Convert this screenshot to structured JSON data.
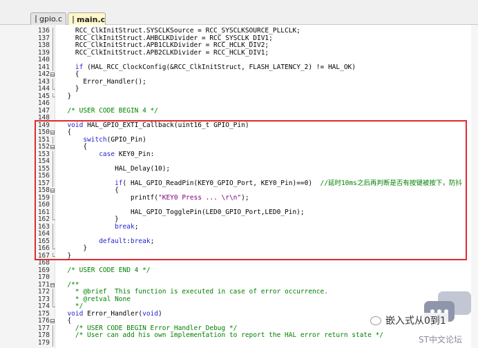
{
  "tabs": [
    {
      "label": "gpio.c",
      "active": false
    },
    {
      "label": "main.c",
      "active": true
    }
  ],
  "code_lines": [
    {
      "num": "136",
      "fold": "vline",
      "html": "    RCC_ClkInitStruct.SYSCLKSource = RCC_SYSCLKSOURCE_PLLCLK;"
    },
    {
      "num": "137",
      "fold": "vline",
      "html": "    RCC_ClkInitStruct.AHBCLKDivider = RCC_SYSCLK_DIV1;"
    },
    {
      "num": "138",
      "fold": "vline",
      "html": "    RCC_ClkInitStruct.APB1CLKDivider = RCC_HCLK_DIV2;"
    },
    {
      "num": "139",
      "fold": "vline",
      "html": "    RCC_ClkInitStruct.APB2CLKDivider = RCC_HCLK_DIV1;"
    },
    {
      "num": "140",
      "fold": "vline",
      "html": ""
    },
    {
      "num": "141",
      "fold": "vline",
      "html": "    <span class=\"k\">if</span> (HAL_RCC_ClockConfig(&RCC_ClkInitStruct, FLASH_LATENCY_2) != HAL_OK)"
    },
    {
      "num": "142",
      "fold": "box",
      "html": "    {"
    },
    {
      "num": "143",
      "fold": "vline",
      "html": "      Error_Handler();"
    },
    {
      "num": "144",
      "fold": "end",
      "html": "    }"
    },
    {
      "num": "145",
      "fold": "end",
      "html": "  }"
    },
    {
      "num": "146",
      "fold": "",
      "html": ""
    },
    {
      "num": "147",
      "fold": "",
      "html": "  <span class=\"c\">/* USER CODE BEGIN 4 */</span>"
    },
    {
      "num": "148",
      "fold": "",
      "html": ""
    },
    {
      "num": "149",
      "fold": "",
      "html": "  <span class=\"k\">void</span> HAL_GPIO_EXTI_Callback(uint16_t GPIO_Pin)"
    },
    {
      "num": "150",
      "fold": "box",
      "html": "  {"
    },
    {
      "num": "151",
      "fold": "vline",
      "html": "      <span class=\"k\">switch</span>(GPIO_Pin)"
    },
    {
      "num": "152",
      "fold": "box",
      "html": "      {"
    },
    {
      "num": "153",
      "fold": "vline",
      "html": "          <span class=\"k\">case</span> KEY0_Pin:"
    },
    {
      "num": "154",
      "fold": "vline",
      "html": ""
    },
    {
      "num": "155",
      "fold": "vline",
      "html": "              HAL_Delay(10);"
    },
    {
      "num": "156",
      "fold": "vline",
      "html": ""
    },
    {
      "num": "157",
      "fold": "vline",
      "html": "              <span class=\"k\">if</span>( HAL_GPIO_ReadPin(KEY0_GPIO_Port, KEY0_Pin)==0)  <span class=\"c\">//延时10ms之后再判断是否有按键被按下，防抖</span>"
    },
    {
      "num": "158",
      "fold": "box",
      "html": "              {"
    },
    {
      "num": "159",
      "fold": "vline",
      "html": "                  printf(<span class=\"s\">\"KEY0 Press ... \\r\\n\"</span>);"
    },
    {
      "num": "160",
      "fold": "vline",
      "html": ""
    },
    {
      "num": "161",
      "fold": "vline",
      "html": "                  HAL_GPIO_TogglePin(LED0_GPIO_Port,LED0_Pin);"
    },
    {
      "num": "162",
      "fold": "end",
      "html": "              }"
    },
    {
      "num": "163",
      "fold": "vline",
      "html": "              <span class=\"k\">break</span>;"
    },
    {
      "num": "164",
      "fold": "vline",
      "html": ""
    },
    {
      "num": "165",
      "fold": "vline",
      "html": "          <span class=\"k\">default</span>:<span class=\"k\">break</span>;"
    },
    {
      "num": "166",
      "fold": "end",
      "html": "      }"
    },
    {
      "num": "167",
      "fold": "end",
      "html": "  }"
    },
    {
      "num": "168",
      "fold": "",
      "html": ""
    },
    {
      "num": "169",
      "fold": "",
      "html": "  <span class=\"c\">/* USER CODE END 4 */</span>"
    },
    {
      "num": "170",
      "fold": "",
      "html": ""
    },
    {
      "num": "171",
      "fold": "box",
      "html": "  <span class=\"c\">/**</span>"
    },
    {
      "num": "172",
      "fold": "vline",
      "html": "<span class=\"c\">    * @brief  This function is executed in case of error occurrence.</span>"
    },
    {
      "num": "173",
      "fold": "vline",
      "html": "<span class=\"c\">    * @retval None</span>"
    },
    {
      "num": "174",
      "fold": "end",
      "html": "<span class=\"c\">    */</span>"
    },
    {
      "num": "175",
      "fold": "",
      "html": "  <span class=\"k\">void</span> Error_Handler(<span class=\"k\">void</span>)"
    },
    {
      "num": "176",
      "fold": "box",
      "html": "  {"
    },
    {
      "num": "177",
      "fold": "vline",
      "html": "    <span class=\"c\">/* USER CODE BEGIN Error_Handler_Debug */</span>"
    },
    {
      "num": "178",
      "fold": "vline",
      "html": "    <span class=\"c\">/* User can add his own implementation to report the HAL error return state */</span>"
    },
    {
      "num": "179",
      "fold": "vline",
      "html": ""
    }
  ],
  "watermark": {
    "text": "嵌入式从0到1",
    "icon": "wechat-icon"
  },
  "forum": {
    "text": "ST中文论坛"
  },
  "colors": {
    "highlight_box": "#e0282d",
    "keyword": "#1f1fd0",
    "comment": "#008000",
    "string": "#800080"
  }
}
